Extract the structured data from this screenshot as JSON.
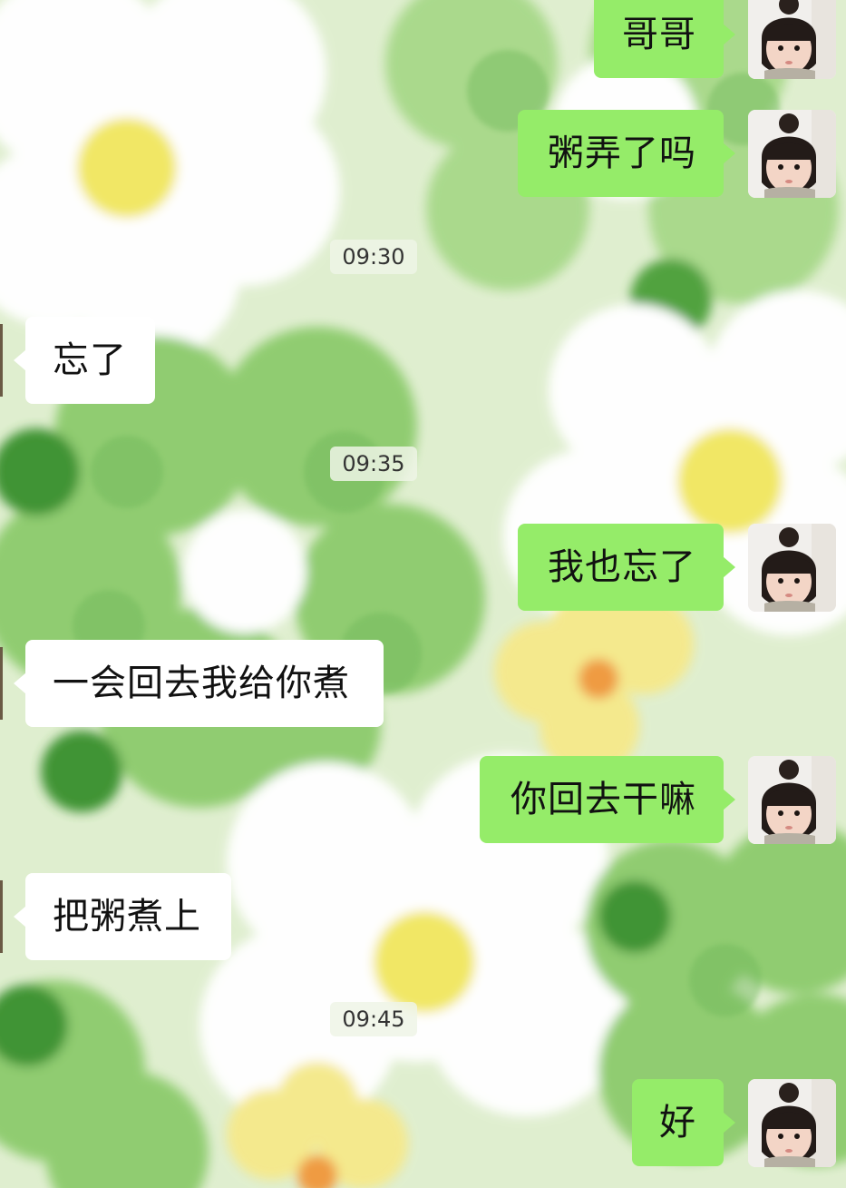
{
  "messages": [
    {
      "id": "m1",
      "side": "right",
      "text": "哥哥"
    },
    {
      "id": "m2",
      "side": "right",
      "text": "粥弄了吗"
    },
    {
      "id": "t1",
      "type": "time",
      "text": "09:30"
    },
    {
      "id": "m3",
      "side": "left",
      "text": "忘了"
    },
    {
      "id": "t2",
      "type": "time",
      "text": "09:35"
    },
    {
      "id": "m4",
      "side": "right",
      "text": "我也忘了"
    },
    {
      "id": "m5",
      "side": "left",
      "text": "一会回去我给你煮"
    },
    {
      "id": "m6",
      "side": "right",
      "text": "你回去干嘛"
    },
    {
      "id": "m7",
      "side": "left",
      "text": "把粥煮上"
    },
    {
      "id": "t3",
      "type": "time",
      "text": "09:45"
    },
    {
      "id": "m8",
      "side": "right",
      "text": "好"
    }
  ],
  "colors": {
    "sent_bubble": "#95ec69",
    "received_bubble": "#ffffff",
    "background": "#dfeecf"
  },
  "icons": {
    "self_avatar": "child-portrait-avatar"
  }
}
